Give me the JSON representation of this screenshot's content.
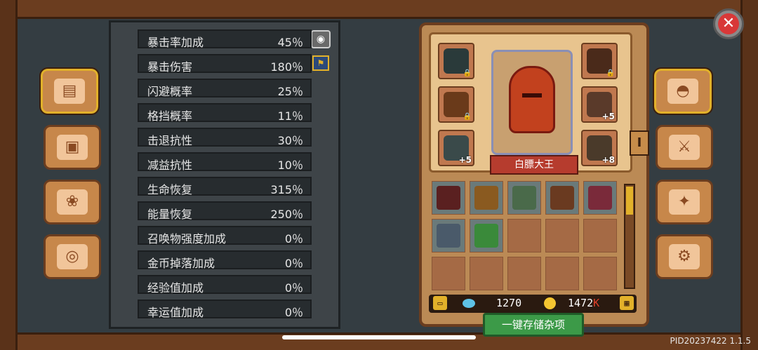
{
  "stats": [
    {
      "label": "暴击率加成",
      "value": "45％"
    },
    {
      "label": "暴击伤害",
      "value": "180％"
    },
    {
      "label": "闪避概率",
      "value": "25％"
    },
    {
      "label": "格挡概率",
      "value": "11％"
    },
    {
      "label": "击退抗性",
      "value": "30％"
    },
    {
      "label": "减益抗性",
      "value": "10％"
    },
    {
      "label": "生命恢复",
      "value": "315％"
    },
    {
      "label": "能量恢复",
      "value": "250％"
    },
    {
      "label": "召唤物强度加成",
      "value": "0％"
    },
    {
      "label": "金币掉落加成",
      "value": "0％"
    },
    {
      "label": "经验值加成",
      "value": "0％"
    },
    {
      "label": "幸运值加成",
      "value": "0％"
    }
  ],
  "character": {
    "name": "白膘大王",
    "level_tag": "I"
  },
  "equip_slots": [
    {
      "icon": "dark-gear-icon",
      "badge": "lock"
    },
    {
      "icon": "amulet-icon",
      "badge": "lock"
    },
    {
      "icon": "boots-icon",
      "badge": "+5"
    },
    {
      "icon": "helmet-icon",
      "badge": "lock"
    },
    {
      "icon": "glove-icon",
      "badge": "+5"
    },
    {
      "icon": "staff-icon",
      "badge": "+8"
    }
  ],
  "inventory": [
    {
      "icon": "sword-icon",
      "color": "#5a2020"
    },
    {
      "icon": "gauntlet-icon",
      "color": "#8a5a20"
    },
    {
      "icon": "bowl-icon",
      "color": "#4a6a4a"
    },
    {
      "icon": "necklace-icon",
      "color": "#6a3a20"
    },
    {
      "icon": "ring-icon",
      "color": "#7a2a3a"
    },
    {
      "icon": "spear-icon",
      "color": "#4a5a6a"
    },
    {
      "icon": "watermelon-icon",
      "color": "#3a8a3a"
    }
  ],
  "currency": {
    "gems": "1270",
    "coins": "1472",
    "coins_suffix": "K"
  },
  "store_button": "一键存储杂项",
  "version": "PID20237422 1.1.5",
  "left_tabs": [
    "book-icon",
    "chest-icon",
    "pets-icon",
    "wheel-icon"
  ],
  "right_tabs": [
    "helmet-tab-icon",
    "weapon-tab-icon",
    "skill-tab-icon",
    "settings-gear-icon"
  ],
  "colors": {
    "accent": "#e2b12a",
    "panel": "#bb8a55",
    "button_green": "#3c9a48"
  }
}
